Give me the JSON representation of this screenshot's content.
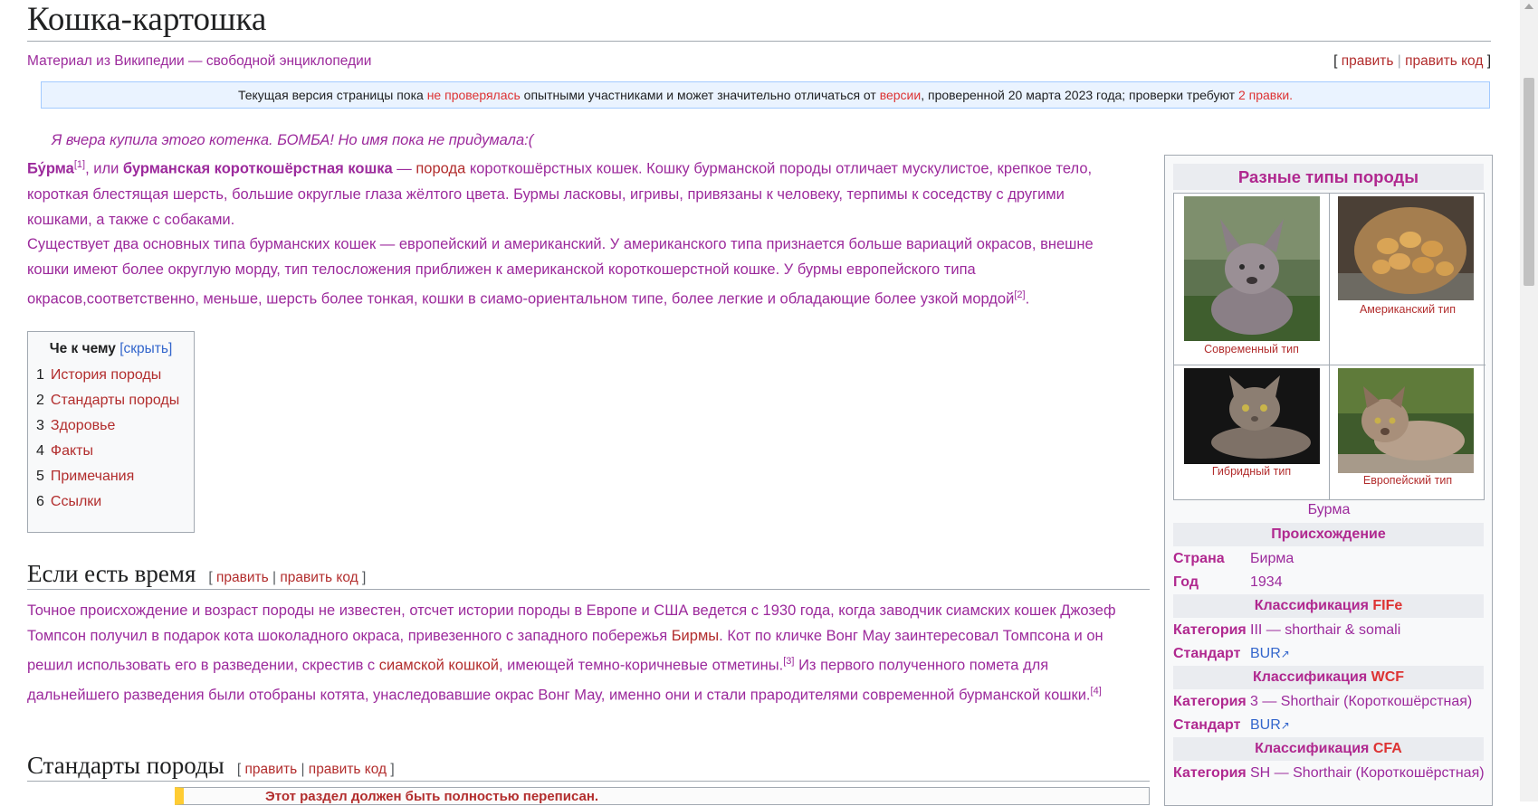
{
  "page": {
    "title": "Кошка-картошка",
    "subtitle": "Материал из Википедии — свободной энциклопедии",
    "edit": {
      "bracket_open": "[",
      "edit_label": "править",
      "sep": "|",
      "edit_code_label": "править код",
      "bracket_close": "]"
    }
  },
  "notice": {
    "part1": "Текущая версия страницы пока ",
    "link1": "не проверялась",
    "part2": " опытными участниками и может значительно отличаться от ",
    "link2": "версии",
    "part3": ", проверенной 20 марта 2023 года; проверки требуют ",
    "link3": "2 правки."
  },
  "hatnote": "Я вчера купила этого котенка. БОМБА! Но имя пока не придумала:(",
  "intro": {
    "p1_bold1": "Бу́рма",
    "p1_sup1": "[1]",
    "p1_t1": ", или ",
    "p1_bold2": "бурманская короткошёрстная кошка",
    "p1_t2": " — ",
    "p1_link": "порода",
    "p1_t3": " короткошёрстных кошек. Кошку бурманской породы отличает мускулистое, крепкое тело, короткая блестящая шерсть, большие округлые глаза жёлтого цвета. Бурмы ласковы, игривы, привязаны к человеку, терпимы к соседству с другими кошками, а также с собаками.",
    "p2_text": "Существует два основных типа бурманских кошек — европейский и американский. У американского типа признается больше вариаций окрасов, внешне кошки имеют более округлую морду, тип телосложения приближен к американской короткошерстной кошке. У бурмы европейского типа окрасов,соответственно, меньше, шерсть более тонкая, кошки в сиамо-ориентальном типе, более легкие и обладающие более узкой мордой",
    "p2_sup": "[2]",
    "p2_end": "."
  },
  "toc": {
    "title": "Че к чему",
    "hide": "[скрыть]",
    "items": [
      {
        "num": "1",
        "label": "История породы"
      },
      {
        "num": "2",
        "label": "Стандарты породы"
      },
      {
        "num": "3",
        "label": "Здоровье"
      },
      {
        "num": "4",
        "label": "Факты"
      },
      {
        "num": "5",
        "label": "Примечания"
      },
      {
        "num": "6",
        "label": "Ссылки"
      }
    ]
  },
  "section1": {
    "heading": "Если есть время",
    "edit": "править",
    "edit_code": "править код",
    "t1": "Точное происхождение и возраст породы не известен, отсчет истории породы в Европе и США ведется с 1930 года, когда заводчик сиамских кошек Джозеф Томпсон получил в подарок кота шоколадного окраса, привезенного с западного побережья ",
    "link1": "Бирмы",
    "t2": ". Кот по кличке Вонг Мау заинтересовал Томпсона и он решил использовать его в разведении, скрестив с ",
    "link2": "сиамской кошкой",
    "t3": ", имеющей темно-коричневые отметины.",
    "sup1": "[3]",
    "t4": " Из первого полученного помета для дальнейшего разведения были отобраны котята, унаследовавшие окрас Вонг Мау, именно они и стали прародителями современной бурманской кошки.",
    "sup2": "[4]"
  },
  "section2": {
    "heading": "Стандарты породы",
    "edit": "править",
    "edit_code": "править код",
    "ambox_text": "Этот раздел должен быть полностью переписан."
  },
  "infobox": {
    "title": "Разные типы породы",
    "gallery": [
      {
        "caption": "Современный тип",
        "image": "french-bulldog-puppy"
      },
      {
        "caption": "Американский тип",
        "image": "potatoes-sack"
      },
      {
        "caption": "Гибридный тип",
        "image": "burmese-cat-lying"
      },
      {
        "caption": "Европейский тип",
        "image": "burmese-cat-outdoor"
      }
    ],
    "caption": "Бурма",
    "origin_header": "Происхождение",
    "country_label": "Страна",
    "country_value": "Бирма",
    "year_label": "Год",
    "year_value": "1934",
    "fife_header_prefix": "Классификация ",
    "fife_header_link": "FIFe",
    "fife_cat_label": "Категория",
    "fife_cat_value": "III — shorthair & somali",
    "fife_std_label": "Стандарт",
    "fife_std_value": "BUR",
    "wcf_header_prefix": "Классификация ",
    "wcf_header_link": "WCF",
    "wcf_cat_label": "Категория",
    "wcf_cat_value": "3 — Shorthair (Короткошёрстная)",
    "wcf_std_label": "Стандарт",
    "wcf_std_value": "BUR",
    "cfa_header_prefix": "Классификация ",
    "cfa_header_link": "CFA",
    "cfa_cat_label": "Категория",
    "cfa_cat_value": "SH — Shorthair (Короткошёрстная)"
  },
  "colors": {
    "text_magenta": "#9c2a9c",
    "link_red": "#b22d2d",
    "link_blue": "#3366cc",
    "notice_bg": "#eaf3ff"
  }
}
